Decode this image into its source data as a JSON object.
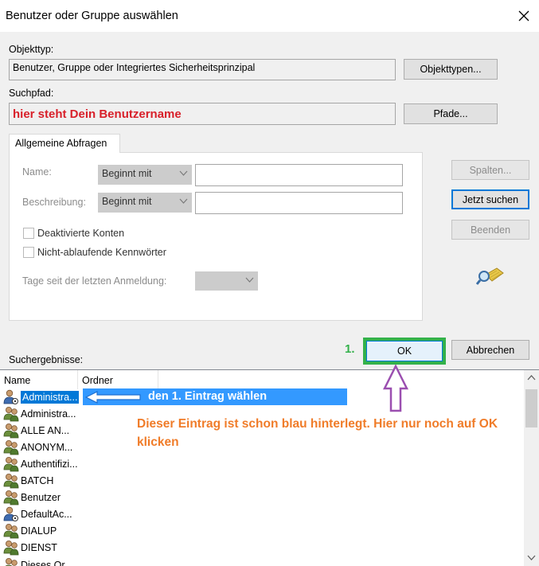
{
  "window": {
    "title": "Benutzer oder Gruppe auswählen"
  },
  "object_type": {
    "label": "Objekttyp:",
    "value": "Benutzer, Gruppe oder Integriertes Sicherheitsprinzipal",
    "button": "Objekttypen..."
  },
  "search_path": {
    "label": "Suchpfad:",
    "value": "hier steht Dein Benutzername",
    "button": "Pfade..."
  },
  "tab": {
    "label": "Allgemeine Abfragen"
  },
  "query": {
    "name_label": "Name:",
    "name_mode": "Beginnt mit",
    "desc_label": "Beschreibung:",
    "desc_mode": "Beginnt mit",
    "disabled_accounts": "Deaktivierte Konten",
    "non_expiring": "Nicht-ablaufende Kennwörter",
    "days_label": "Tage seit der letzten Anmeldung:"
  },
  "side_buttons": {
    "columns": "Spalten...",
    "search_now": "Jetzt suchen",
    "stop": "Beenden"
  },
  "results": {
    "label": "Suchergebnisse:",
    "col_name": "Name",
    "col_folder": "Ordner",
    "rows": [
      "Administra...",
      "Administra...",
      "ALLE AN...",
      "ANONYM...",
      "Authentifizi...",
      "BATCH",
      "Benutzer",
      "DefaultAc...",
      "DIALUP",
      "DIENST",
      "Dieses Or..."
    ]
  },
  "dialog_buttons": {
    "ok": "OK",
    "cancel": "Abbrechen"
  },
  "annotations": {
    "step": "1.",
    "row_hint": "den 1. Eintrag wählen",
    "note": "Dieser Eintrag ist schon blau hinterlegt. Hier nur noch auf OK klicken"
  },
  "colors": {
    "accent": "#0078d7",
    "green": "#33b14a",
    "purple": "#9b4fb0",
    "orange": "#f07c29",
    "red": "#d8202a"
  }
}
